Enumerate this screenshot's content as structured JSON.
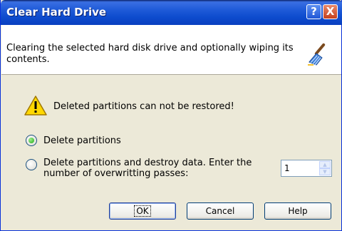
{
  "window": {
    "title": "Clear Hard Drive"
  },
  "titlebar": {
    "help_glyph": "?",
    "close_glyph": "X"
  },
  "header": {
    "description": "Clearing the selected hard disk drive and optionally wiping its contents.",
    "icon": "broom-icon"
  },
  "warning": {
    "icon": "warning-icon",
    "text": "Deleted partitions can not be restored!"
  },
  "options": [
    {
      "label": "Delete partitions",
      "checked": true
    },
    {
      "label": "Delete partitions and destroy data. Enter the number of overwritting passes:",
      "checked": false
    }
  ],
  "passes": {
    "value": "1"
  },
  "buttons": {
    "ok": "OK",
    "cancel": "Cancel",
    "help": "Help"
  },
  "colors": {
    "title_bar": "#0a4bcd",
    "dialog_bg": "#ece9d8",
    "close_button": "#c4401d"
  }
}
